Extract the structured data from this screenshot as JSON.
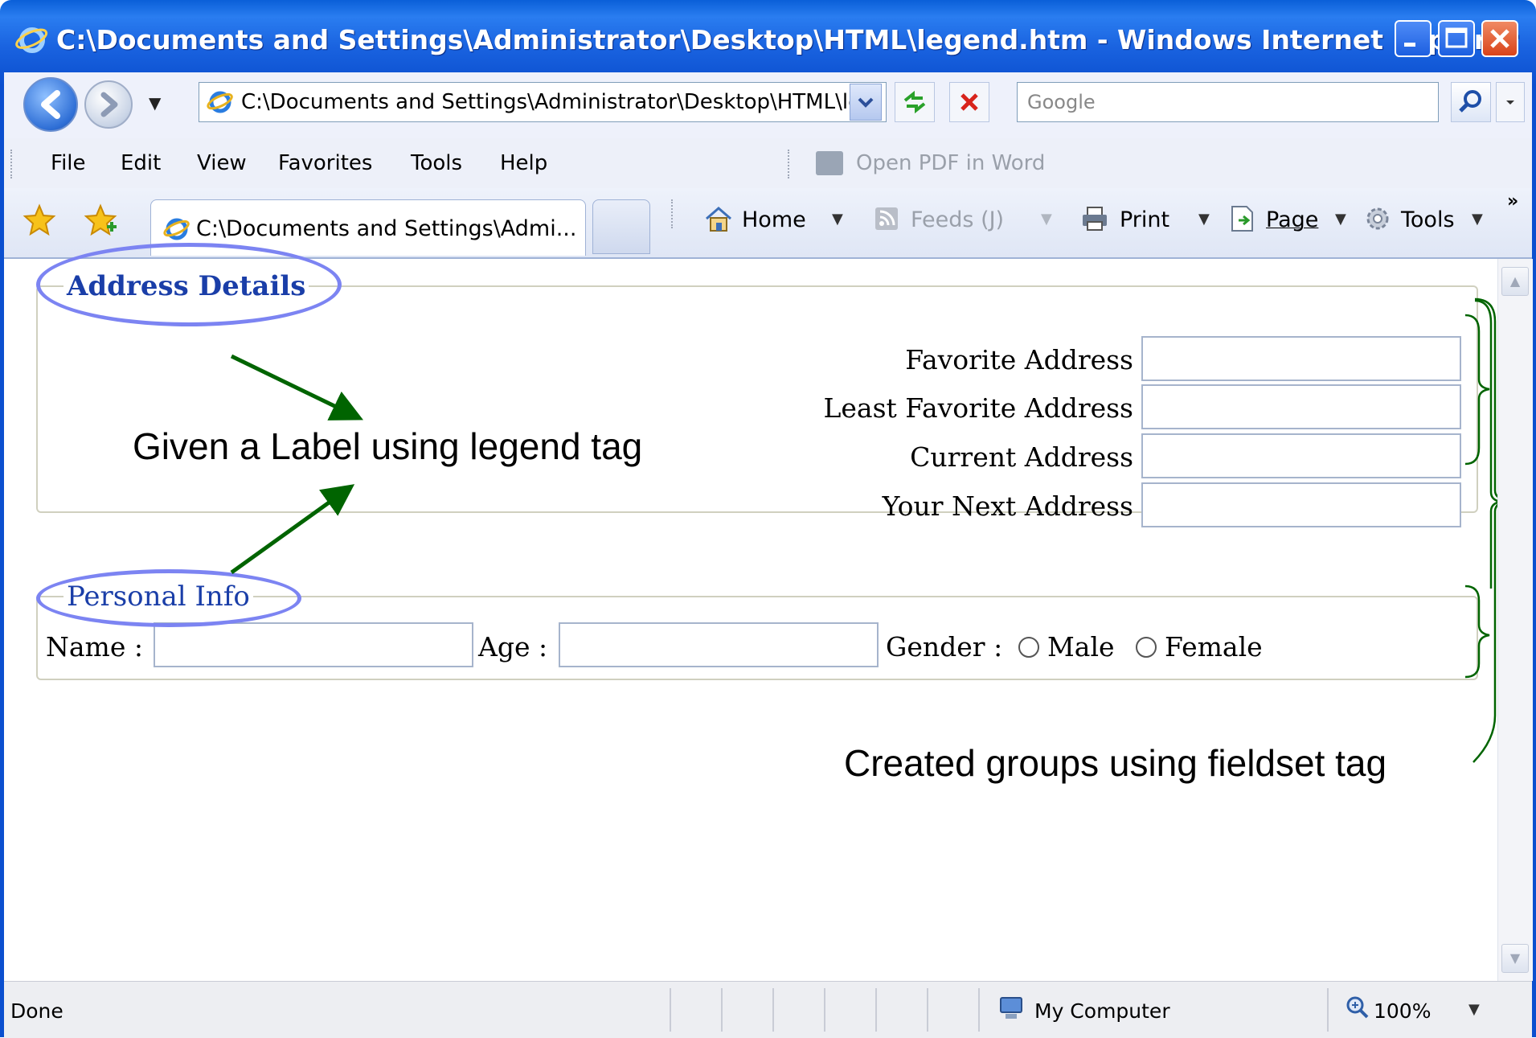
{
  "window": {
    "title": "C:\\Documents and Settings\\Administrator\\Desktop\\HTML\\legend.htm - Windows Internet Explorer"
  },
  "address_bar": {
    "url": "C:\\Documents and Settings\\Administrator\\Desktop\\HTML\\legend.htm",
    "search_placeholder": "Google"
  },
  "menu": {
    "items": [
      "File",
      "Edit",
      "View",
      "Favorites",
      "Tools",
      "Help"
    ],
    "pdf_button": "Open PDF in Word"
  },
  "tabs": {
    "active_tab_label": "C:\\Documents and Settings\\Admi..."
  },
  "command_bar": {
    "home": "Home",
    "feeds": "Feeds (J)",
    "print": "Print",
    "page": "Page",
    "tools": "Tools"
  },
  "page": {
    "address_fieldset": {
      "legend": "Address Details",
      "fields": [
        {
          "label": "Favorite Address",
          "value": ""
        },
        {
          "label": "Least Favorite Address",
          "value": ""
        },
        {
          "label": "Current Address",
          "value": ""
        },
        {
          "label": "Your Next Address",
          "value": ""
        }
      ]
    },
    "personal_fieldset": {
      "legend": "Personal Info",
      "name_label": "Name :",
      "name_value": "",
      "age_label": "Age :",
      "age_value": "",
      "gender_label": "Gender :",
      "gender_options": [
        "Male",
        "Female"
      ],
      "gender_selected": ""
    }
  },
  "annotations": {
    "legend_note": "Given a Label using legend tag",
    "fieldset_note": "Created groups using fieldset tag",
    "ellipse_color": "#7c84f2",
    "arrow_color": "#006400",
    "brace_color": "#006400"
  },
  "status_bar": {
    "status": "Done",
    "zone": "My Computer",
    "zoom": "100%"
  },
  "colors": {
    "titlebar": "#0b4fcf",
    "legend_text": "#1a3ea8"
  }
}
